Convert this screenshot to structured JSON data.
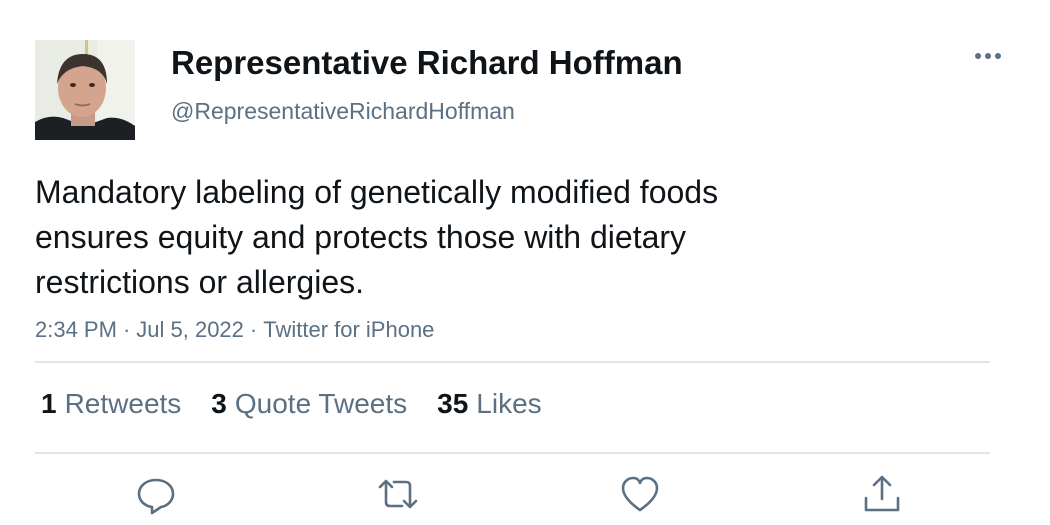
{
  "user": {
    "display_name": "Representative Richard Hoffman",
    "handle": "@RepresentativeRichardHoffman"
  },
  "tweet": {
    "text": "Mandatory labeling of genetically modified foods ensures equity and protects those with dietary restrictions or allergies.",
    "time": "2:34 PM",
    "date": "Jul 5, 2022",
    "source": "Twitter for iPhone",
    "separator": "·"
  },
  "stats": {
    "retweets": {
      "count": "1",
      "label": "Retweets"
    },
    "quote_tweets": {
      "count": "3",
      "label": "Quote Tweets"
    },
    "likes": {
      "count": "35",
      "label": "Likes"
    }
  },
  "icons": {
    "more": "more-horizontal-icon",
    "reply": "reply-icon",
    "retweet": "retweet-icon",
    "like": "heart-icon",
    "share": "share-icon"
  },
  "colors": {
    "text_primary": "#0f1419",
    "text_secondary": "#5b7083",
    "divider": "#e1e5e8"
  }
}
